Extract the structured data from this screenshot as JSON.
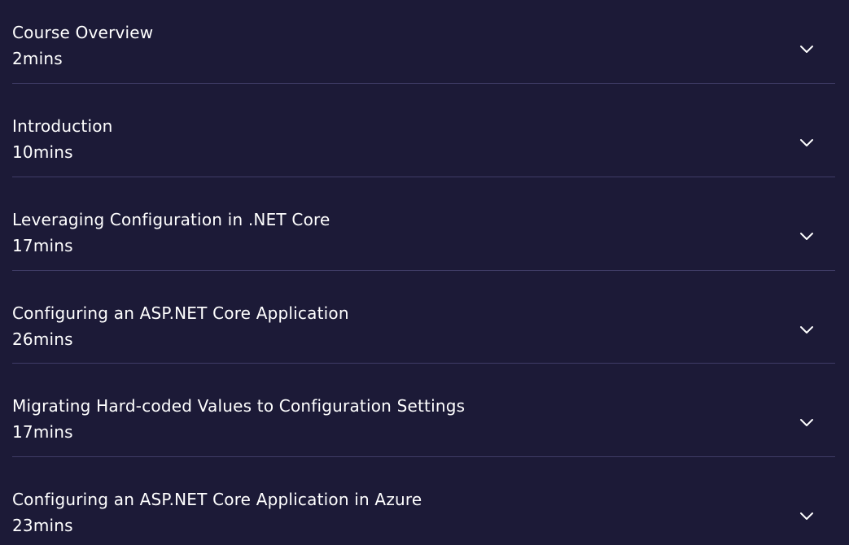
{
  "modules": [
    {
      "title": "Course Overview",
      "duration": "2mins"
    },
    {
      "title": "Introduction",
      "duration": "10mins"
    },
    {
      "title": "Leveraging Configuration in .NET Core",
      "duration": "17mins"
    },
    {
      "title": "Configuring an ASP.NET Core Application",
      "duration": "26mins"
    },
    {
      "title": "Migrating Hard-coded Values to Configuration Settings",
      "duration": "17mins"
    },
    {
      "title": "Configuring an ASP.NET Core Application in Azure",
      "duration": "23mins"
    }
  ],
  "colors": {
    "background": "#1c1a37",
    "text": "#ffffff",
    "divider": "#3f3c66"
  },
  "icons": {
    "expand": "chevron-down-icon"
  }
}
